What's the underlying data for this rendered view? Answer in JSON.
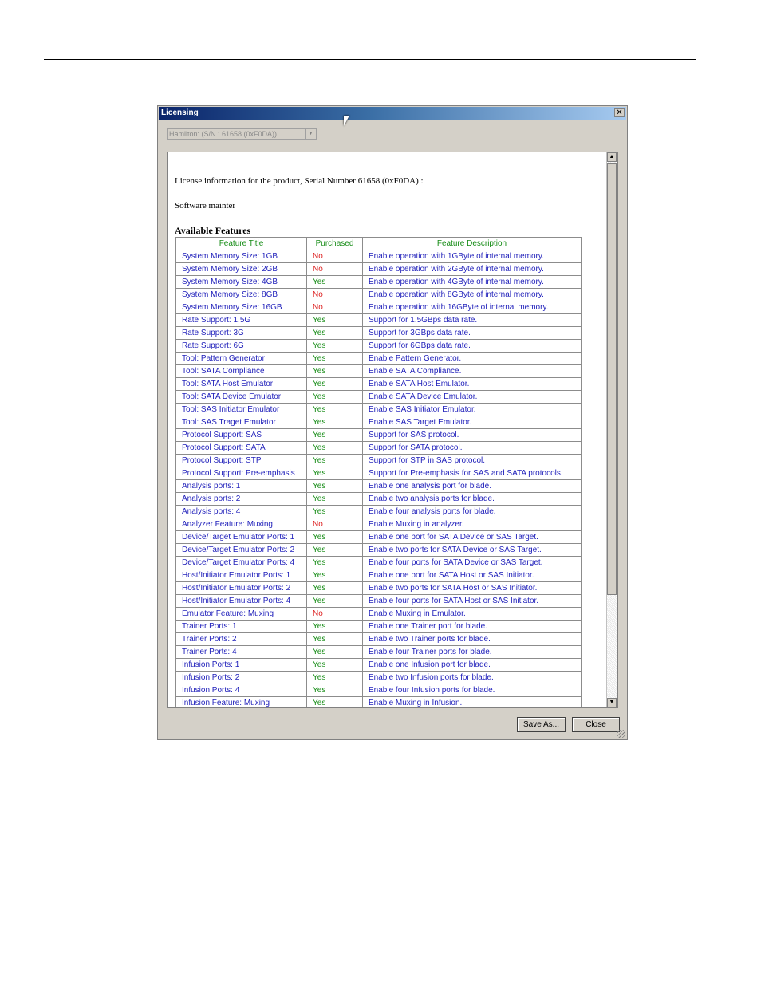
{
  "window": {
    "title": "Licensing",
    "close_glyph": "✕"
  },
  "product_select": {
    "value": "Hamilton: (S/N : 61658 (0xF0DA))",
    "arrow_glyph": "▼"
  },
  "content": {
    "license_line": "License information for the product, Serial Number 61658 (0xF0DA) :",
    "maintenance_line": "Software mainter",
    "section_title": "Available Features"
  },
  "table": {
    "headers": [
      "Feature Title",
      "Purchased",
      "Feature Description"
    ],
    "rows": [
      {
        "title": "System Memory Size: 1GB",
        "purchased": "No",
        "desc": "Enable operation with 1GByte of internal memory."
      },
      {
        "title": "System Memory Size: 2GB",
        "purchased": "No",
        "desc": "Enable operation with 2GByte of internal memory."
      },
      {
        "title": "System Memory Size: 4GB",
        "purchased": "Yes",
        "desc": "Enable operation with 4GByte of internal memory."
      },
      {
        "title": "System Memory Size: 8GB",
        "purchased": "No",
        "desc": "Enable operation with 8GByte of internal memory."
      },
      {
        "title": "System Memory Size: 16GB",
        "purchased": "No",
        "desc": "Enable operation with 16GByte of internal memory."
      },
      {
        "title": "Rate Support: 1.5G",
        "purchased": "Yes",
        "desc": "Support for 1.5GBps data rate."
      },
      {
        "title": "Rate Support: 3G",
        "purchased": "Yes",
        "desc": "Support for 3GBps data rate."
      },
      {
        "title": "Rate Support: 6G",
        "purchased": "Yes",
        "desc": "Support for 6GBps data rate."
      },
      {
        "title": "Tool: Pattern Generator",
        "purchased": "Yes",
        "desc": "Enable Pattern Generator."
      },
      {
        "title": "Tool: SATA Compliance",
        "purchased": "Yes",
        "desc": "Enable SATA Compliance."
      },
      {
        "title": "Tool: SATA Host Emulator",
        "purchased": "Yes",
        "desc": "Enable SATA Host Emulator."
      },
      {
        "title": "Tool: SATA Device Emulator",
        "purchased": "Yes",
        "desc": "Enable SATA Device Emulator."
      },
      {
        "title": "Tool: SAS Initiator Emulator",
        "purchased": "Yes",
        "desc": "Enable SAS Initiator Emulator."
      },
      {
        "title": "Tool: SAS Traget Emulator",
        "purchased": "Yes",
        "desc": "Enable SAS Target Emulator."
      },
      {
        "title": "Protocol Support: SAS",
        "purchased": "Yes",
        "desc": "Support for SAS protocol."
      },
      {
        "title": "Protocol Support: SATA",
        "purchased": "Yes",
        "desc": "Support for SATA protocol."
      },
      {
        "title": "Protocol Support: STP",
        "purchased": "Yes",
        "desc": "Support for STP in SAS protocol."
      },
      {
        "title": "Protocol Support: Pre-emphasis",
        "purchased": "Yes",
        "desc": "Support for Pre-emphasis for SAS and SATA protocols."
      },
      {
        "title": "Analysis ports: 1",
        "purchased": "Yes",
        "desc": "Enable one analysis port for blade."
      },
      {
        "title": "Analysis ports: 2",
        "purchased": "Yes",
        "desc": "Enable two analysis ports for blade."
      },
      {
        "title": "Analysis ports: 4",
        "purchased": "Yes",
        "desc": "Enable four analysis ports for blade."
      },
      {
        "title": "Analyzer Feature: Muxing",
        "purchased": "No",
        "desc": "Enable Muxing in analyzer."
      },
      {
        "title": "Device/Target Emulator Ports: 1",
        "purchased": "Yes",
        "desc": "Enable one port for SATA Device or SAS Target."
      },
      {
        "title": "Device/Target Emulator Ports: 2",
        "purchased": "Yes",
        "desc": "Enable two ports for SATA Device or SAS Target."
      },
      {
        "title": "Device/Target Emulator Ports: 4",
        "purchased": "Yes",
        "desc": "Enable four ports for SATA Device or SAS Target."
      },
      {
        "title": "Host/Initiator Emulator Ports: 1",
        "purchased": "Yes",
        "desc": "Enable one port for SATA Host or SAS Initiator."
      },
      {
        "title": "Host/Initiator Emulator Ports: 2",
        "purchased": "Yes",
        "desc": "Enable two ports for SATA Host or SAS Initiator."
      },
      {
        "title": "Host/Initiator Emulator Ports: 4",
        "purchased": "Yes",
        "desc": "Enable four ports for SATA Host or SAS Initiator."
      },
      {
        "title": "Emulator Feature: Muxing",
        "purchased": "No",
        "desc": "Enable Muxing in Emulator."
      },
      {
        "title": "Trainer Ports: 1",
        "purchased": "Yes",
        "desc": "Enable one Trainer port for blade."
      },
      {
        "title": "Trainer Ports: 2",
        "purchased": "Yes",
        "desc": "Enable two Trainer ports for blade."
      },
      {
        "title": "Trainer Ports: 4",
        "purchased": "Yes",
        "desc": "Enable four Trainer ports for blade."
      },
      {
        "title": "Infusion Ports: 1",
        "purchased": "Yes",
        "desc": "Enable one Infusion port for blade."
      },
      {
        "title": "Infusion Ports: 2",
        "purchased": "Yes",
        "desc": "Enable two Infusion ports for blade."
      },
      {
        "title": "Infusion Ports: 4",
        "purchased": "Yes",
        "desc": "Enable four Infusion ports for blade."
      },
      {
        "title": "Infusion Feature: Muxing",
        "purchased": "Yes",
        "desc": "Enable Muxing in Infusion."
      }
    ]
  },
  "buttons": {
    "save_as": "Save As...",
    "close": "Close"
  },
  "scrollbar": {
    "up_glyph": "▲",
    "down_glyph": "▼"
  },
  "colors": {
    "title_link": "#2222bb",
    "header": "#168c16",
    "yes": "#168c16",
    "no": "#dd2222"
  }
}
